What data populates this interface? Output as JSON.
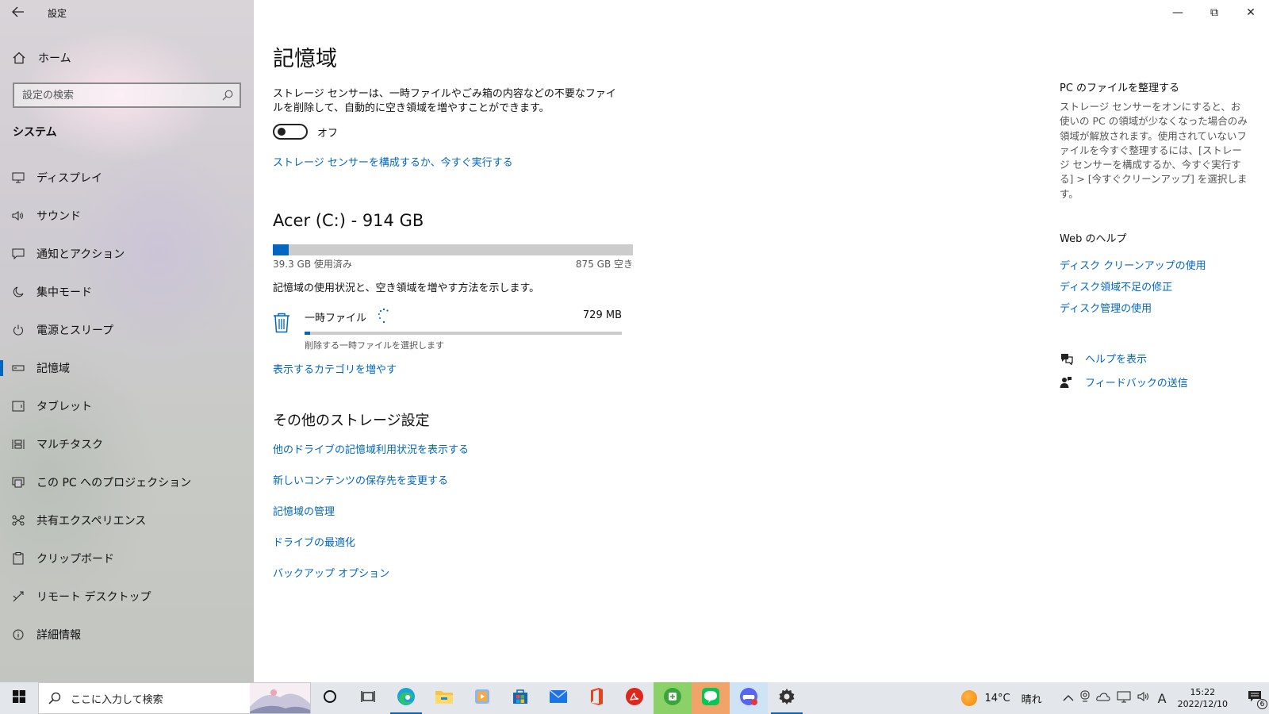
{
  "window": {
    "app_title": "設定",
    "back_icon": "back-arrow-icon",
    "controls": {
      "minimize": "—",
      "restore": "⧉",
      "close": "✕"
    }
  },
  "sidebar": {
    "home_label": "ホーム",
    "search_placeholder": "設定の検索",
    "section": "システム",
    "items": [
      {
        "label": "ディスプレイ",
        "icon": "display-icon"
      },
      {
        "label": "サウンド",
        "icon": "speaker-icon"
      },
      {
        "label": "通知とアクション",
        "icon": "notification-icon"
      },
      {
        "label": "集中モード",
        "icon": "moon-icon"
      },
      {
        "label": "電源とスリープ",
        "icon": "power-icon"
      },
      {
        "label": "記憶域",
        "icon": "storage-icon",
        "active": true
      },
      {
        "label": "タブレット",
        "icon": "tablet-icon"
      },
      {
        "label": "マルチタスク",
        "icon": "multitask-icon"
      },
      {
        "label": "この PC へのプロジェクション",
        "icon": "projection-icon"
      },
      {
        "label": "共有エクスペリエンス",
        "icon": "shared-icon"
      },
      {
        "label": "クリップボード",
        "icon": "clipboard-icon"
      },
      {
        "label": "リモート デスクトップ",
        "icon": "remote-icon"
      },
      {
        "label": "詳細情報",
        "icon": "info-icon"
      }
    ]
  },
  "main": {
    "title": "記憶域",
    "description": "ストレージ センサーは、一時ファイルやごみ箱の内容などの不要なファイルを削除して、自動的に空き領域を増やすことができます。",
    "toggle_state": "オフ",
    "configure_link": "ストレージ センサーを構成するか、今すぐ実行する",
    "drive": {
      "title": "Acer (C:) - 914 GB",
      "used_label": "39.3 GB 使用済み",
      "free_label": "875 GB 空き",
      "used_fraction": 0.043,
      "description": "記憶域の使用状況と、空き領域を増やす方法を示します。"
    },
    "category": {
      "name": "一時ファイル",
      "size": "729 MB",
      "subtitle": "削除する一時ファイルを選択します",
      "fraction": 0.018
    },
    "more_categories_link": "表示するカテゴリを増やす",
    "other_heading": "その他のストレージ設定",
    "other_links": [
      "他のドライブの記憶域利用状況を表示する",
      "新しいコンテンツの保存先を変更する",
      "記憶域の管理",
      "ドライブの最適化",
      "バックアップ オプション"
    ]
  },
  "aside": {
    "tidy_heading": "PC のファイルを整理する",
    "tidy_text": "ストレージ センサーをオンにすると、お使いの PC の領域が少なくなった場合のみ領域が解放されます。使用されていないファイルを今すぐ整理するには、[ストレージ センサーを構成するか、今すぐ実行する] > [今すぐクリーンアップ] を選択します。",
    "web_heading": "Web のヘルプ",
    "web_links": [
      "ディスク クリーンアップの使用",
      "ディスク領域不足の修正",
      "ディスク管理の使用"
    ],
    "help_label": "ヘルプを表示",
    "feedback_label": "フィードバックの送信"
  },
  "taskbar": {
    "search_placeholder": "ここに入力して検索",
    "weather_temp": "14°C",
    "weather_text": "晴れ",
    "ime": "A",
    "time": "15:22",
    "date": "2022/12/10",
    "notification_count": "6",
    "apps": [
      "cortana-icon",
      "task-view-icon",
      "edge-icon",
      "file-explorer-icon",
      "video-editor-icon",
      "store-icon",
      "mail-icon",
      "office-icon",
      "acrobat-icon",
      "green-app-icon",
      "line-icon",
      "game-app-icon",
      "settings-icon"
    ],
    "accent": "#0067c0"
  }
}
